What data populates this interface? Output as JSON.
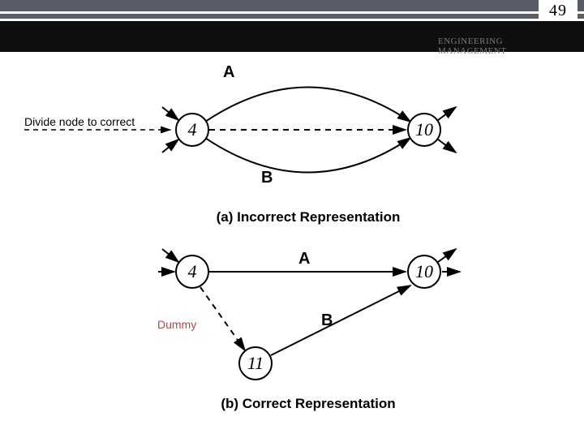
{
  "page_number": "49",
  "header": {
    "line1": "ENGINEERING",
    "line2": "MANAGEMENT"
  },
  "diagram_a": {
    "hint": "Divide node to correct",
    "activity_top": "A",
    "activity_bottom": "B",
    "node_left": "4",
    "node_right": "10",
    "caption": "(a) Incorrect Representation"
  },
  "diagram_b": {
    "activity_top": "A",
    "activity_mid": "B",
    "dummy_label": "Dummy",
    "node_left": "4",
    "node_right": "10",
    "node_bottom": "11",
    "caption": "(b) Correct Representation"
  }
}
